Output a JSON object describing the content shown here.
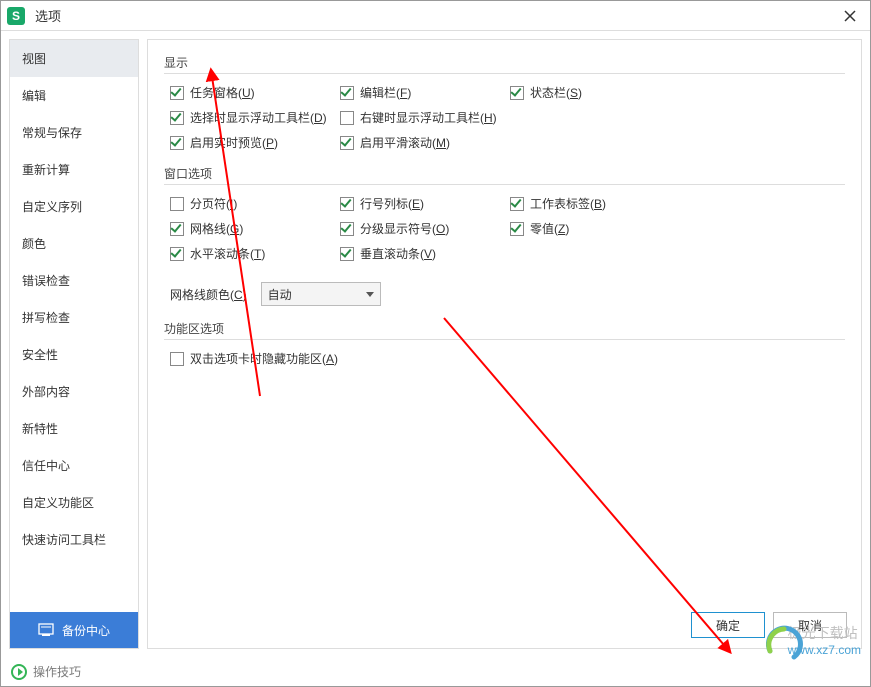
{
  "titlebar": {
    "app_glyph": "S",
    "title": "选项"
  },
  "sidebar": {
    "items": [
      "视图",
      "编辑",
      "常规与保存",
      "重新计算",
      "自定义序列",
      "颜色",
      "错误检查",
      "拼写检查",
      "安全性",
      "外部内容",
      "新特性",
      "信任中心",
      "自定义功能区",
      "快速访问工具栏"
    ],
    "backup_label": "备份中心"
  },
  "content": {
    "section_display": "显示",
    "display": [
      {
        "label": "任务窗格(",
        "u": "U",
        "tail": ")",
        "checked": true
      },
      {
        "label": "编辑栏(",
        "u": "F",
        "tail": ")",
        "checked": true
      },
      {
        "label": "状态栏(",
        "u": "S",
        "tail": ")",
        "checked": true
      },
      {
        "label": "选择时显示浮动工具栏(",
        "u": "D",
        "tail": ")",
        "checked": true
      },
      {
        "label": "右键时显示浮动工具栏(",
        "u": "H",
        "tail": ")",
        "checked": false
      },
      {
        "label": "",
        "u": "",
        "tail": "",
        "checked": null
      },
      {
        "label": "启用实时预览(",
        "u": "P",
        "tail": ")",
        "checked": true
      },
      {
        "label": "启用平滑滚动(",
        "u": "M",
        "tail": ")",
        "checked": true
      }
    ],
    "section_window": "窗口选项",
    "window": [
      {
        "label": "分页符(",
        "u": "I",
        "tail": ")",
        "checked": false
      },
      {
        "label": "行号列标(",
        "u": "E",
        "tail": ")",
        "checked": true
      },
      {
        "label": "工作表标签(",
        "u": "B",
        "tail": ")",
        "checked": true
      },
      {
        "label": "网格线(",
        "u": "G",
        "tail": ")",
        "checked": true
      },
      {
        "label": "分级显示符号(",
        "u": "O",
        "tail": ")",
        "checked": true
      },
      {
        "label": "零值(",
        "u": "Z",
        "tail": ")",
        "checked": true
      },
      {
        "label": "水平滚动条(",
        "u": "T",
        "tail": ")",
        "checked": true
      },
      {
        "label": "垂直滚动条(",
        "u": "V",
        "tail": ")",
        "checked": true
      }
    ],
    "gridline_color_label": "网格线颜色(",
    "gridline_color_u": "C",
    "gridline_color_tail": ")",
    "gridline_color_value": "自动",
    "section_ribbon": "功能区选项",
    "ribbon": [
      {
        "label": "双击选项卡时隐藏功能区(",
        "u": "A",
        "tail": ")",
        "checked": false
      }
    ],
    "ok": "确定",
    "cancel": "取消"
  },
  "footer": {
    "tip": "操作技巧"
  },
  "watermark": {
    "line1": "极光下载站",
    "line2": "www.xz7.com"
  }
}
